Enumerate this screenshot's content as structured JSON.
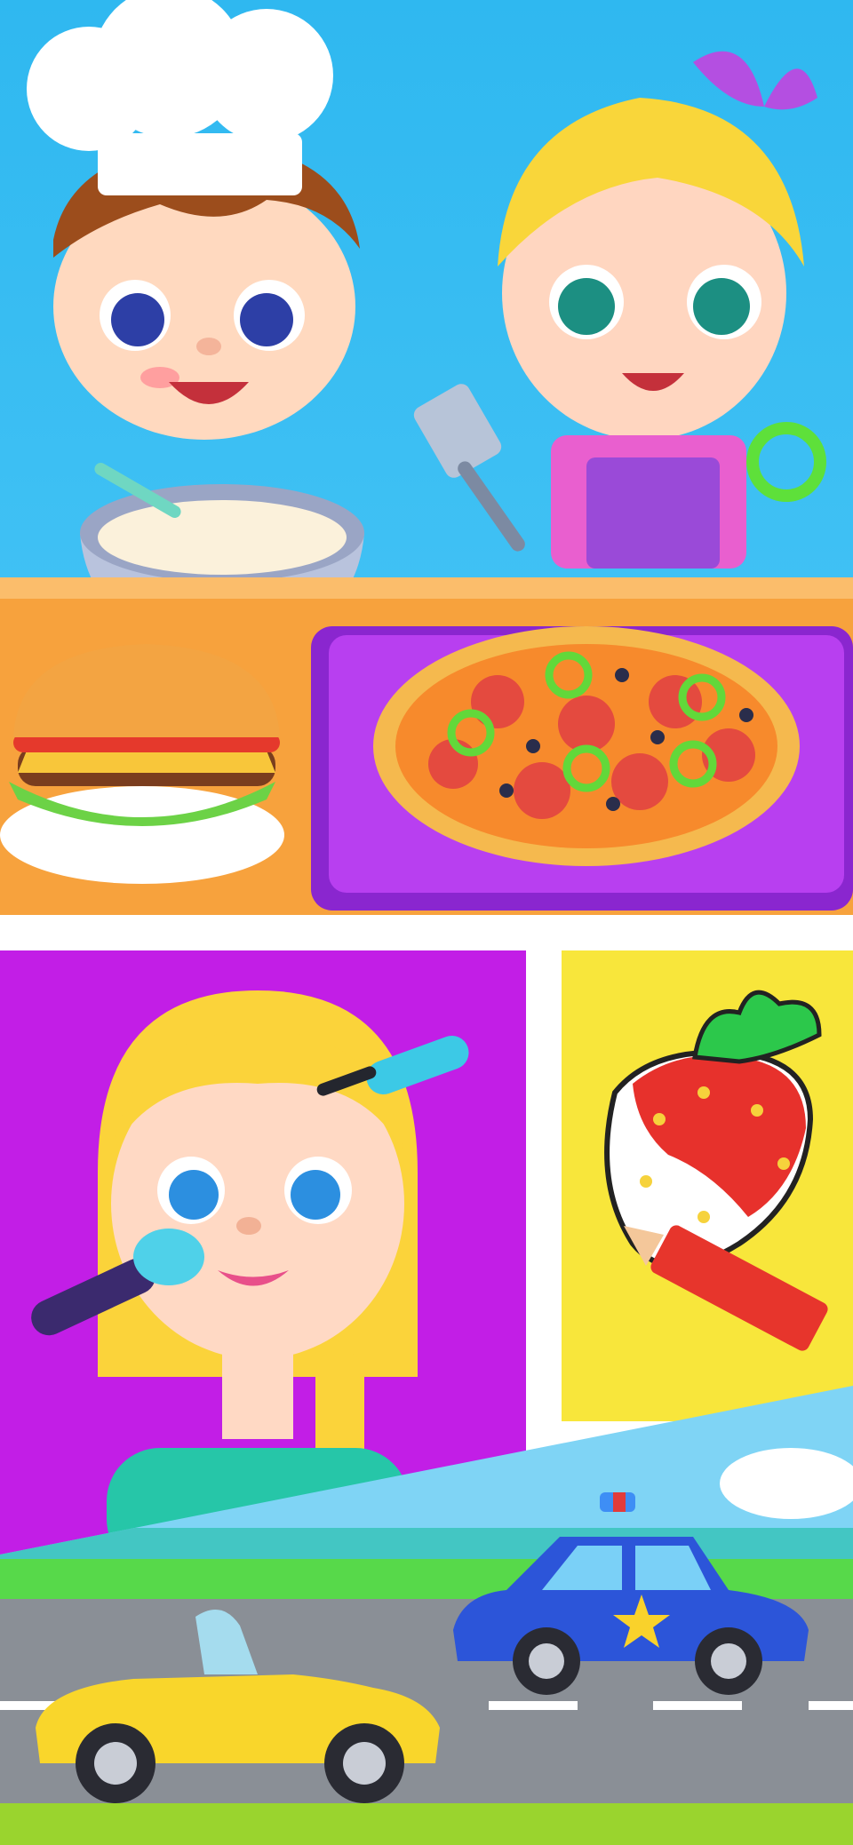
{
  "screen": {
    "panels": [
      {
        "id": "cooking",
        "theme": "cooking game"
      },
      {
        "id": "makeup",
        "theme": "makeup game"
      },
      {
        "id": "coloring",
        "theme": "coloring game"
      },
      {
        "id": "cars",
        "theme": "cars game"
      }
    ]
  },
  "colors": {
    "sky_blue": "#2fb8f0",
    "counter_orange": "#f7a23d",
    "tray_purple": "#b83ff0",
    "makeup_bg": "#c21ee6",
    "coloring_bg": "#f8e63b",
    "grass": "#57d94a",
    "road": "#8a8f96",
    "police_blue": "#2c55d9",
    "sports_car_yellow": "#f9d62b"
  },
  "icons": [
    "chef-hat-icon",
    "spatula-icon",
    "bowl-icon",
    "burger-icon",
    "pizza-icon",
    "mascara-icon",
    "makeup-brush-icon",
    "strawberry-icon",
    "pencil-icon",
    "police-car-icon",
    "sports-car-icon",
    "star-icon"
  ]
}
